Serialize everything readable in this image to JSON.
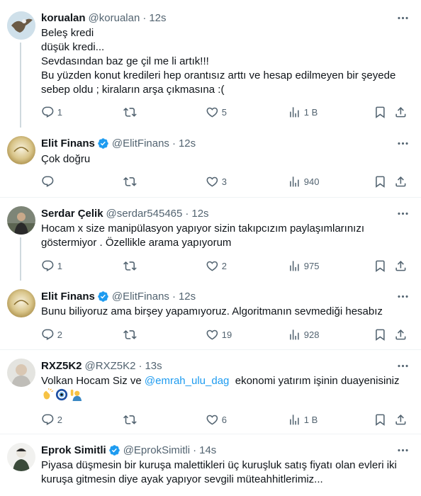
{
  "tweets": [
    {
      "name": "korualan",
      "handle": "@korualan",
      "dot": "·",
      "time": "12s",
      "verified": false,
      "text": "Beleş kredi\ndüşük kredi...\nSevdasından baz ge çil me li artık!!!\nBu yüzden konut kredileri hep orantısız arttı ve hesap edilmeyen bir şeyede sebep oldu ; kiraların arşa çıkmasına :(",
      "replies": "1",
      "retweets": "",
      "likes": "5",
      "views": "1 B"
    },
    {
      "name": "Elit Finans",
      "handle": "@ElitFinans",
      "dot": "·",
      "time": "12s",
      "verified": true,
      "text": "Çok doğru",
      "replies": "",
      "retweets": "",
      "likes": "3",
      "views": "940"
    },
    {
      "name": "Serdar Çelik",
      "handle": "@serdar545465",
      "dot": "·",
      "time": "12s",
      "verified": false,
      "text": "Hocam x size manipülasyon  yapıyor  sizin takıpcızım  paylaşımlarınızı göstermiyor . Özellikle arama yapıyorum",
      "replies": "1",
      "retweets": "",
      "likes": "2",
      "views": "975"
    },
    {
      "name": "Elit Finans",
      "handle": "@ElitFinans",
      "dot": "·",
      "time": "12s",
      "verified": true,
      "text": "Bunu biliyoruz ama birşey yapamıyoruz. Algoritmanın sevmediği hesabız",
      "replies": "2",
      "retweets": "",
      "likes": "19",
      "views": "928"
    },
    {
      "name": "RXZ5K2",
      "handle": "@RXZ5K2",
      "dot": "·",
      "time": "13s",
      "verified": false,
      "text_before": "Volkan Hocam Siz ve ",
      "mention": "@emrah_ulu_dag",
      "text_after": "  ekonomi yatırım işinin duayenisiniz",
      "emojis": [
        "clapping-hands-emoji",
        "nazar-amulet-emoji",
        "person-raising-hand-emoji"
      ],
      "replies": "2",
      "retweets": "",
      "likes": "6",
      "views": "1 B"
    },
    {
      "name": "Eprok Simitli",
      "handle": "@EprokSimitli",
      "dot": "·",
      "time": "14s",
      "verified": true,
      "text": "Piyasa düşmesin bir kuruşa malettikleri üç kuruşluk satış fiyatı olan evleri iki kuruşa gitmesin diye ayak yapıyor sevgili müteahhitlerimiz..."
    }
  ],
  "colors": {
    "text": "#0f1419",
    "secondary": "#536471",
    "accent": "#1d9bf0",
    "divider": "#eff3f4",
    "thread_line": "#cfd9de"
  },
  "icons": [
    "reply-icon",
    "retweet-icon",
    "like-icon",
    "views-icon",
    "bookmark-icon",
    "share-icon",
    "more-icon",
    "verified-badge-icon"
  ]
}
